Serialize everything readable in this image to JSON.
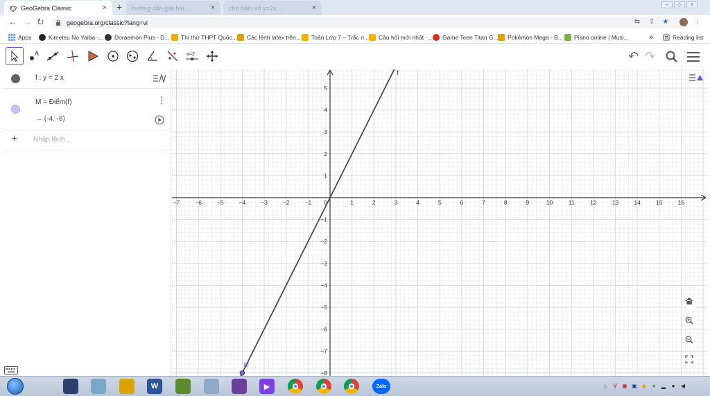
{
  "browser": {
    "tabs": [
      {
        "label": "GeoGebra Classic",
        "active": true
      },
      {
        "label": "hướng dẫn giải bài...",
        "active": false
      },
      {
        "label": "cho hàm số y=2x ...",
        "active": false
      }
    ],
    "tab_close_glyph": "×",
    "new_tab_glyph": "+",
    "url": "geogebra.org/classic?lang=vi",
    "bookmarks": [
      {
        "label": "Apps",
        "color": "#4285f4"
      },
      {
        "label": "Kimetsu No Yaiba -...",
        "color": "#222222"
      },
      {
        "label": "Doraemon Plus - D...",
        "color": "#333333"
      },
      {
        "label": "Thi thử THPT Quốc...",
        "color": "#f2a900"
      },
      {
        "label": "Các lệnh latex trên...",
        "color": "#e0a200"
      },
      {
        "label": "Toán Lớp 7 – Trắc n...",
        "color": "#f0b400"
      },
      {
        "label": "Câu hỏi mới nhất -...",
        "color": "#f0b400"
      },
      {
        "label": "Game Teen Titan G...",
        "color": "#d93025"
      },
      {
        "label": "Pokémon Mega - B...",
        "color": "#e0a200"
      },
      {
        "label": "Piano online | Musi...",
        "color": "#7cb342"
      }
    ],
    "bookmarks_overflow": "»",
    "reading_list": "Reading list"
  },
  "ggb": {
    "accent": "#6557d2",
    "algebra": {
      "rows": [
        {
          "input": "f : y = 2 x",
          "marble_color": "#616161"
        },
        {
          "input": "M = Điểm(f)",
          "output": "→ (-4, -8)",
          "marble_color": "#c7c3f5"
        }
      ],
      "input_placeholder": "Nhập lệnh...",
      "add_glyph": "+"
    },
    "graphics": {
      "function_label": "f",
      "point_label": "M",
      "point": {
        "x": -4,
        "y": -8
      },
      "slope": 2,
      "x_ticks": [
        -7,
        -6,
        -5,
        -4,
        -3,
        -2,
        -1,
        1,
        2,
        3,
        4,
        5,
        6,
        7,
        8,
        9,
        10,
        11,
        12,
        13,
        14,
        15,
        16
      ],
      "y_ticks": [
        -8,
        -7,
        -6,
        -5,
        -4,
        -3,
        -2,
        -1,
        1,
        2,
        3,
        4,
        5
      ],
      "origin_label": "0",
      "line_color": "#444444",
      "point_color": "#6a6adf"
    }
  },
  "taskbar": {
    "apps": [
      {
        "name": "media",
        "color": "#2a3f6e",
        "glyph": ""
      },
      {
        "name": "recycle",
        "color": "#7aa7c7",
        "glyph": ""
      },
      {
        "name": "pikachu",
        "color": "#d9a400",
        "glyph": ""
      },
      {
        "name": "word",
        "color": "#2b579a",
        "glyph": "W"
      },
      {
        "name": "minecraft",
        "color": "#5c8b2f",
        "glyph": ""
      },
      {
        "name": "files",
        "color": "#8fa9c8",
        "glyph": ""
      },
      {
        "name": "game",
        "color": "#6b3fa0",
        "glyph": ""
      },
      {
        "name": "vs",
        "color": "#7b3fe4",
        "glyph": "▶"
      },
      {
        "name": "chrome",
        "color": "#db4437",
        "glyph": ""
      },
      {
        "name": "chrome-dev",
        "color": "#0f9d58",
        "glyph": ""
      },
      {
        "name": "chrome-alt",
        "color": "#db4437",
        "glyph": ""
      },
      {
        "name": "zalo",
        "color": "#0068ff",
        "glyph": "Zalo"
      }
    ]
  }
}
